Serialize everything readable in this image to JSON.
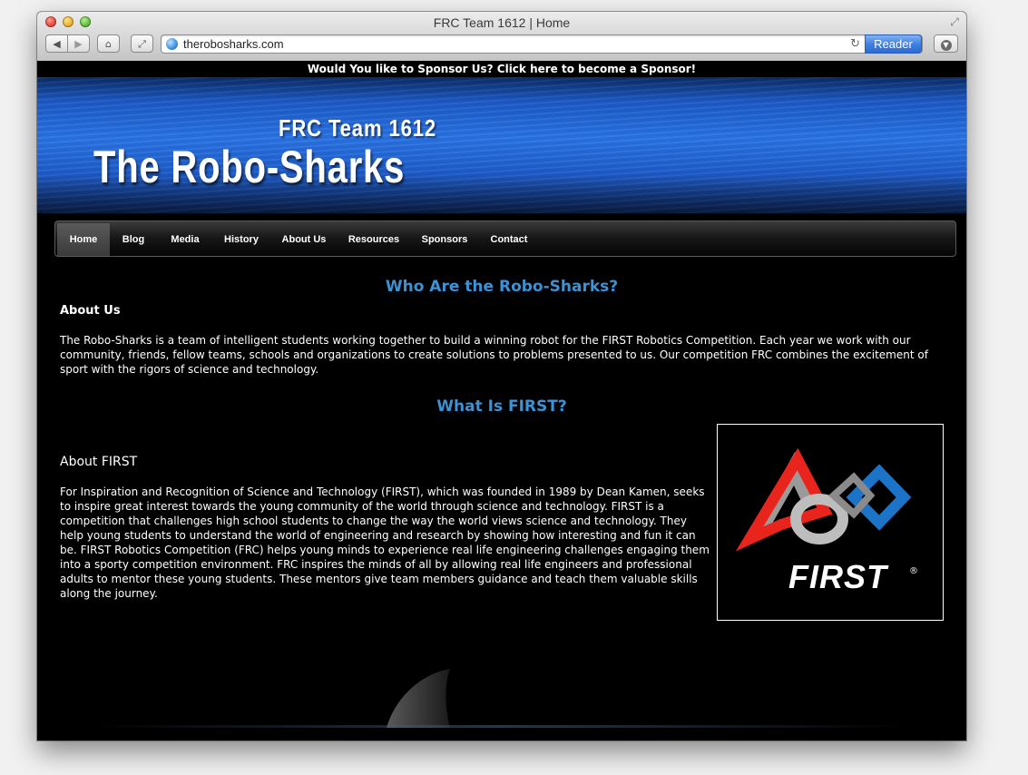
{
  "browser": {
    "window_title": "FRC Team 1612 | Home",
    "url": "therobosharks.com",
    "reader_label": "Reader"
  },
  "page": {
    "sponsor_banner": "Would You like to Sponsor Us? Click here to become a Sponsor!",
    "header": {
      "team_number": "FRC Team 1612",
      "team_name": "The Robo-Sharks"
    },
    "nav": {
      "items": [
        {
          "label": "Home",
          "active": true
        },
        {
          "label": "Blog"
        },
        {
          "label": "Media"
        },
        {
          "label": "History"
        },
        {
          "label": "About Us"
        },
        {
          "label": "Resources"
        },
        {
          "label": "Sponsors"
        },
        {
          "label": "Contact"
        }
      ]
    },
    "section1": {
      "title": "Who Are the Robo-Sharks?",
      "subheading": "About Us",
      "body": "The Robo-Sharks is a team of intelligent students working together to build a winning robot for the FIRST Robotics Competition. Each year we work with our community, friends, fellow teams, schools and organizations to create solutions to problems presented to us. Our competition FRC combines the excitement of sport with the rigors of science and technology."
    },
    "section2": {
      "title": "What Is FIRST?",
      "subheading": "About FIRST",
      "body": "For Inspiration and Recognition of Science and Technology (FIRST), which was founded in 1989 by Dean Kamen, seeks to inspire great interest towards the young community of the world through science and technology. FIRST is a competition that challenges high school students to change the way the world views science and technology. They help young students to understand the world of engineering and research by showing how interesting and fun it can be. FIRST Robotics Competition (FRC) helps young minds to experience real life engineering challenges engaging them into a sporty competition environment. FRC inspires the minds of all by allowing real life engineers and professional adults to mentor these young students. These mentors give team members guidance and teach them valuable skills along the journey.",
      "logo_text": "FIRST",
      "logo_mark": "®"
    }
  },
  "colors": {
    "heading_blue": "#3a93d6",
    "logo_red": "#e8241c",
    "logo_blue": "#1b74c8"
  }
}
